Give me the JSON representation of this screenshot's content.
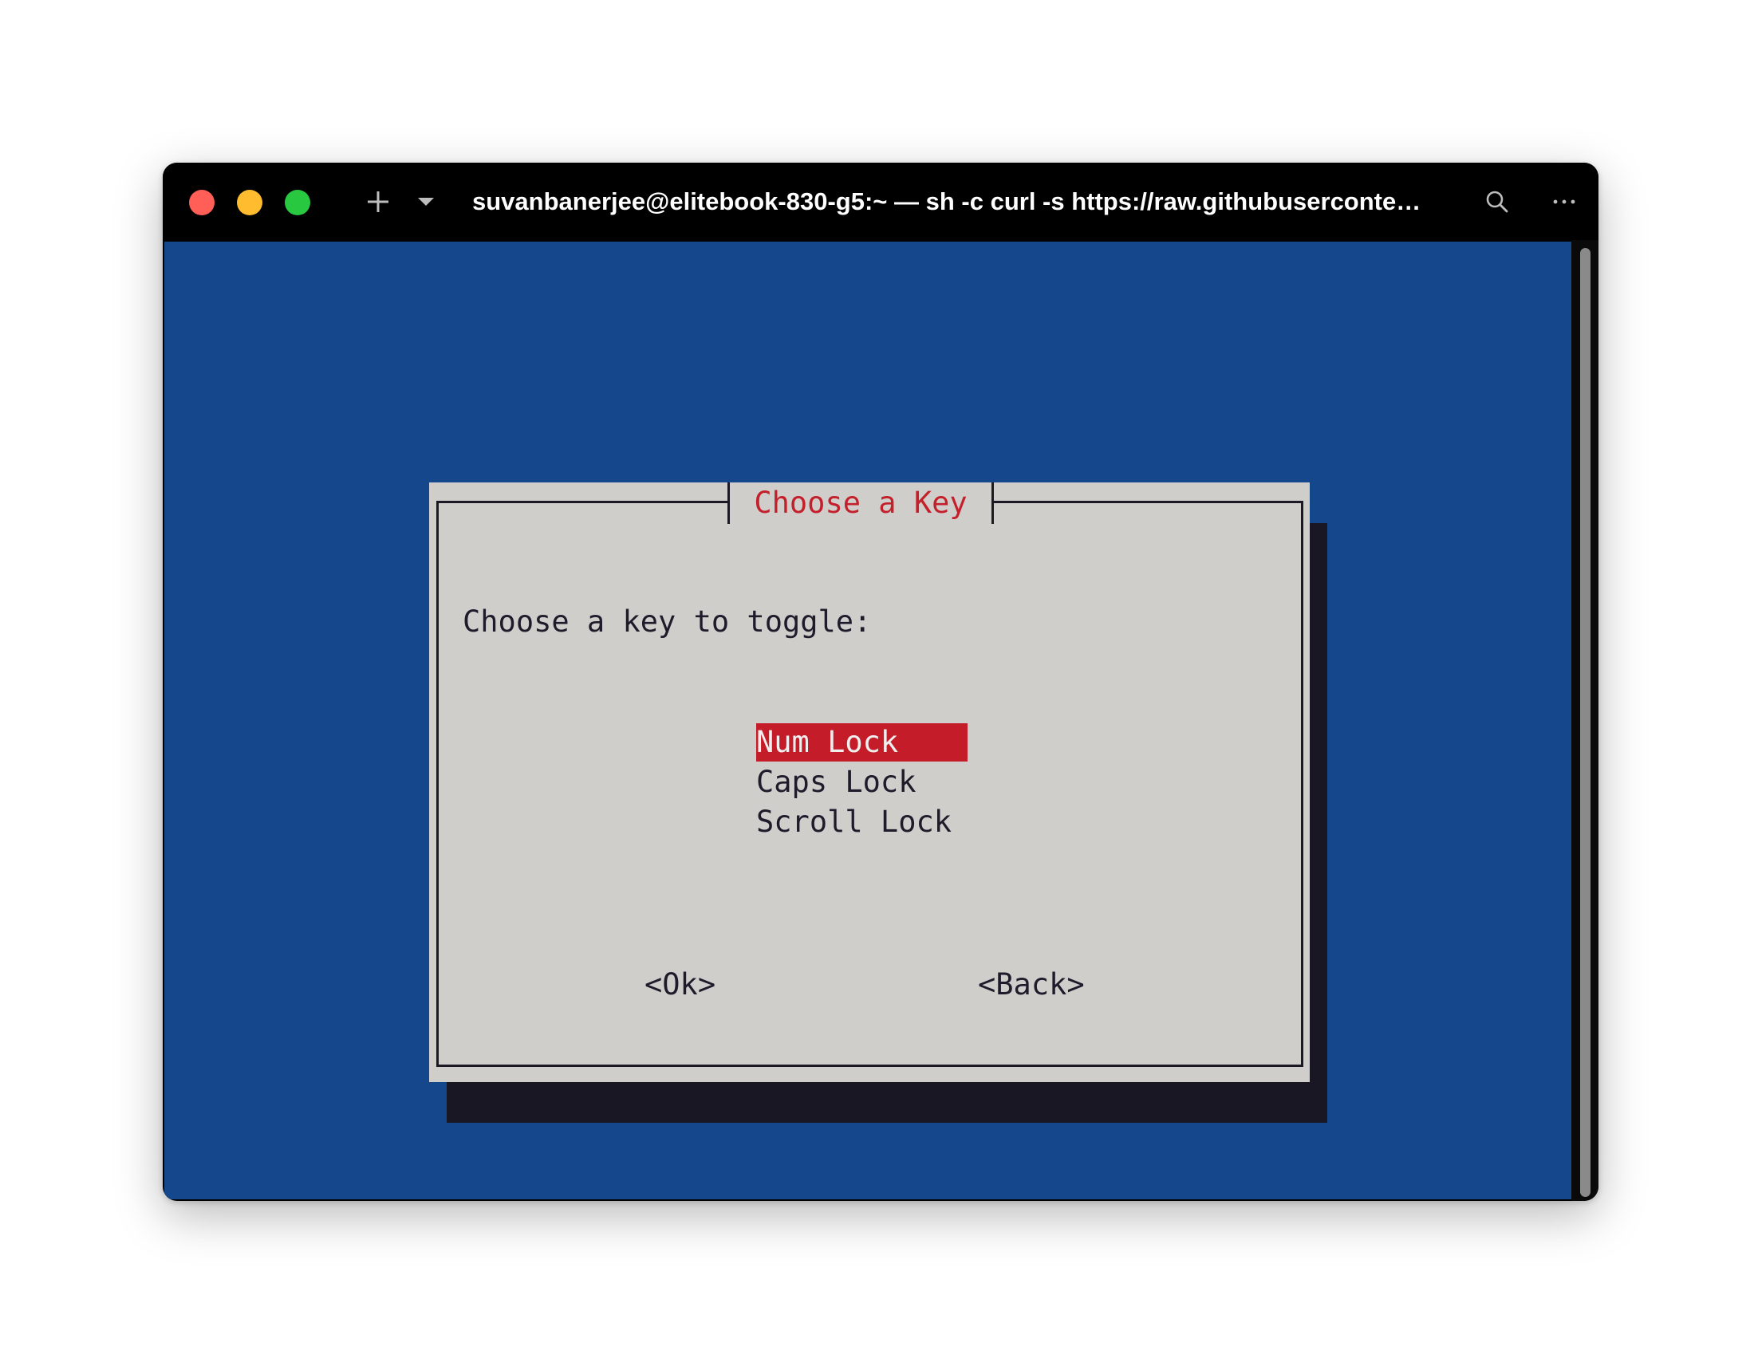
{
  "window": {
    "title": "suvanbanerjee@elitebook-830-g5:~ — sh -c curl -s https://raw.githubuserconte…",
    "icons": [
      "close-button",
      "minimize-button",
      "maximize-button",
      "plus-icon",
      "chevron-down-icon",
      "search-icon",
      "more-icon"
    ]
  },
  "colors": {
    "terminal_bg": "#14478b",
    "dialog_bg": "#d0cecb",
    "accent_red": "#c41d29",
    "text_dark": "#1e1c2b"
  },
  "dialog": {
    "title": "Choose a Key",
    "prompt": "Choose a key to toggle:",
    "options": [
      "Num Lock",
      "Caps Lock",
      "Scroll Lock"
    ],
    "selected_option": "Num Lock",
    "buttons": {
      "ok": "<Ok>",
      "back": "<Back>"
    }
  }
}
